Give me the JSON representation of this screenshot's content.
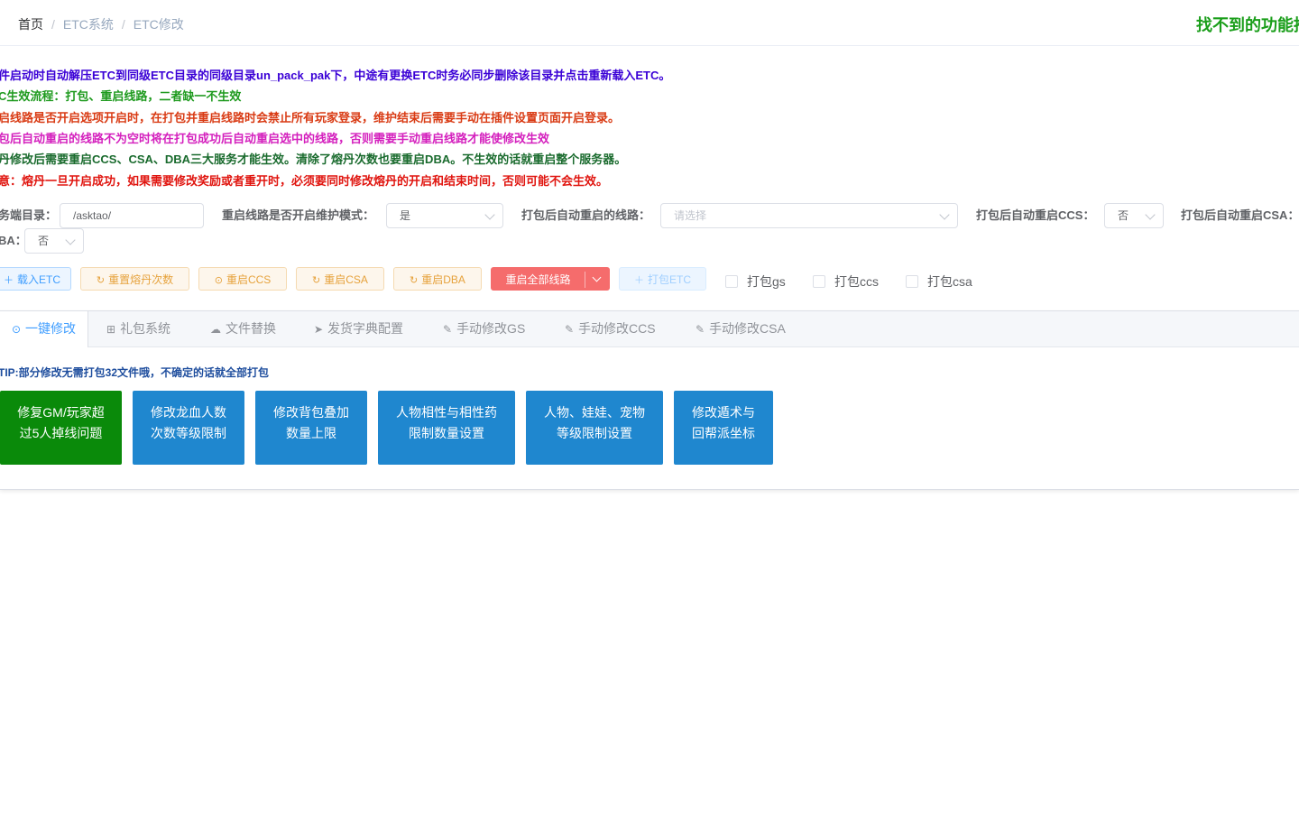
{
  "breadcrumb": [
    "首页",
    "ETC系统",
    "ETC修改"
  ],
  "top_right_text": "找不到的功能推",
  "notices": [
    {
      "text": "件启动时自动解压ETC到同级ETC目录的同级目录un_pack_pak下，中途有更换ETC时务必同步删除该目录并点击重新载入ETC。",
      "color": "#3a00d6"
    },
    {
      "text": "C生效流程：打包、重启线路，二者缺一不生效",
      "color": "#1e9a1e"
    },
    {
      "text": "启线路是否开启选项开启时，在打包并重启线路时会禁止所有玩家登录，维护结束后需要手动在插件设置页面开启登录。",
      "color": "#d93b14"
    },
    {
      "text": "包后自动重启的线路不为空时将在打包成功后自动重启选中的线路，否则需要手动重启线路才能使修改生效",
      "color": "#d41fbd"
    },
    {
      "text": "丹修改后需要重启CCS、CSA、DBA三大服务才能生效。清除了熔丹次数也要重启DBA。不生效的话就重启整个服务器。",
      "color": "#1a6b2e"
    },
    {
      "text": "意：熔丹一旦开启成功，如果需要修改奖励或者重开时，必须要同时修改熔丹的开启和结束时间，否则可能不会生效。",
      "color": "#e0150f"
    }
  ],
  "form": {
    "server_dir_label": "务端目录：",
    "server_dir_value": "/asktao/",
    "maintenance_label": "重启线路是否开启维护模式：",
    "maintenance_value": "是",
    "auto_restart_lines_label": "打包后自动重启的线路：",
    "auto_restart_lines_placeholder": "请选择",
    "auto_restart_ccs_label": "打包后自动重启CCS：",
    "auto_restart_ccs_value": "否",
    "auto_restart_csa_label": "打包后自动重启CSA：",
    "auto_restart_dba_label": "BA：",
    "auto_restart_dba_value": "否"
  },
  "buttons": {
    "load_etc": "载入ETC",
    "reset_rongdan": "重置熔丹次数",
    "restart_ccs": "重启CCS",
    "restart_csa": "重启CSA",
    "restart_dba": "重启DBA",
    "restart_all_lines": "重启全部线路",
    "pack_etc": "打包ETC"
  },
  "checkboxes": [
    "打包gs",
    "打包ccs",
    "打包csa"
  ],
  "tabs": [
    "一键修改",
    "礼包系统",
    "文件替换",
    "发货字典配置",
    "手动修改GS",
    "手动修改CCS",
    "手动修改CSA"
  ],
  "tip": "TIP:部分修改无需打包32文件哦，不确定的话就全部打包",
  "cards": [
    {
      "line1": "修复GM/玩家超",
      "line2": "过5人掉线问题",
      "color": "#0a8a0a"
    },
    {
      "line1": "修改龙血人数",
      "line2": "次数等级限制",
      "color": "#1f87cf"
    },
    {
      "line1": "修改背包叠加",
      "line2": "数量上限",
      "color": "#1f87cf"
    },
    {
      "line1": "人物相性与相性药",
      "line2": "限制数量设置",
      "color": "#1f87cf"
    },
    {
      "line1": "人物、娃娃、宠物",
      "line2": "等级限制设置",
      "color": "#1f87cf"
    },
    {
      "line1": "修改遁术与",
      "line2": "回帮派坐标",
      "color": "#1f87cf"
    }
  ]
}
